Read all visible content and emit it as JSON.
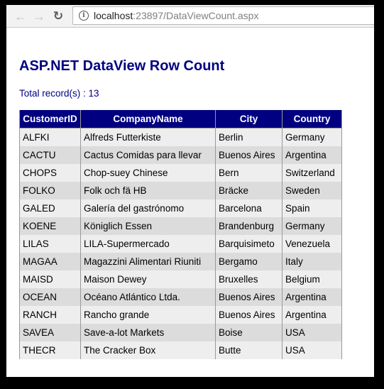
{
  "browser": {
    "url_host": "localhost",
    "url_rest": ":23897/DataViewCount.aspx",
    "icons": {
      "back": "arrow-left-icon",
      "forward": "arrow-right-icon",
      "reload": "reload-icon",
      "info": "info-icon"
    }
  },
  "page": {
    "title": "ASP.NET DataView Row Count",
    "total_label": "Total record(s) : 13"
  },
  "table": {
    "columns": [
      "CustomerID",
      "CompanyName",
      "City",
      "Country"
    ],
    "rows": [
      [
        "ALFKI",
        "Alfreds Futterkiste",
        "Berlin",
        "Germany"
      ],
      [
        "CACTU",
        "Cactus Comidas para llevar",
        "Buenos Aires",
        "Argentina"
      ],
      [
        "CHOPS",
        "Chop-suey Chinese",
        "Bern",
        "Switzerland"
      ],
      [
        "FOLKO",
        "Folk och fä HB",
        "Bräcke",
        "Sweden"
      ],
      [
        "GALED",
        "Galería del gastrónomo",
        "Barcelona",
        "Spain"
      ],
      [
        "KOENE",
        "Königlich Essen",
        "Brandenburg",
        "Germany"
      ],
      [
        "LILAS",
        "LILA-Supermercado",
        "Barquisimeto",
        "Venezuela"
      ],
      [
        "MAGAA",
        "Magazzini Alimentari Riuniti",
        "Bergamo",
        "Italy"
      ],
      [
        "MAISD",
        "Maison Dewey",
        "Bruxelles",
        "Belgium"
      ],
      [
        "OCEAN",
        "Océano Atlántico Ltda.",
        "Buenos Aires",
        "Argentina"
      ],
      [
        "RANCH",
        "Rancho grande",
        "Buenos Aires",
        "Argentina"
      ],
      [
        "SAVEA",
        "Save-a-lot Markets",
        "Boise",
        "USA"
      ],
      [
        "THECR",
        "The Cracker Box",
        "Butte",
        "USA"
      ]
    ]
  },
  "colors": {
    "heading": "#000080",
    "header_bg": "#000080",
    "row_odd": "#eeeeee",
    "row_even": "#dcdcdc"
  }
}
